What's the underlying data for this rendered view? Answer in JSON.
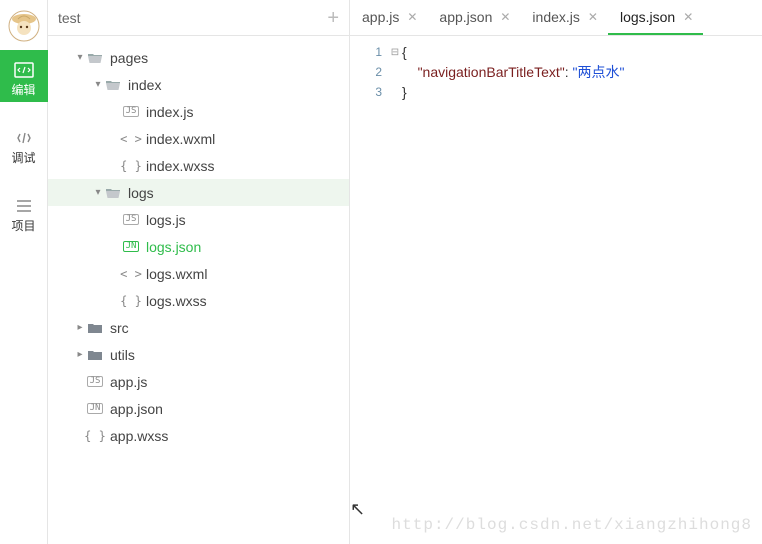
{
  "rail": {
    "items": [
      {
        "name": "编辑",
        "icon": "code-icon",
        "active": true
      },
      {
        "name": "调试",
        "icon": "debug-icon",
        "active": false
      },
      {
        "name": "项目",
        "icon": "menu-icon",
        "active": false
      }
    ]
  },
  "explorer": {
    "title": "test",
    "tree": [
      {
        "label": "pages",
        "type": "folder-open",
        "indent": 1,
        "caret": "down"
      },
      {
        "label": "index",
        "type": "folder-open",
        "indent": 2,
        "caret": "down"
      },
      {
        "label": "index.js",
        "type": "js",
        "indent": 3,
        "caret": ""
      },
      {
        "label": "index.wxml",
        "type": "angle",
        "indent": 3,
        "caret": ""
      },
      {
        "label": "index.wxss",
        "type": "brace",
        "indent": 3,
        "caret": ""
      },
      {
        "label": "logs",
        "type": "folder-open",
        "indent": 2,
        "caret": "down",
        "highlight": true
      },
      {
        "label": "logs.js",
        "type": "js",
        "indent": 3,
        "caret": ""
      },
      {
        "label": "logs.json",
        "type": "jn",
        "indent": 3,
        "caret": "",
        "selected": true
      },
      {
        "label": "logs.wxml",
        "type": "angle",
        "indent": 3,
        "caret": ""
      },
      {
        "label": "logs.wxss",
        "type": "brace",
        "indent": 3,
        "caret": ""
      },
      {
        "label": "src",
        "type": "folder",
        "indent": 1,
        "caret": "right"
      },
      {
        "label": "utils",
        "type": "folder",
        "indent": 1,
        "caret": "right"
      },
      {
        "label": "app.js",
        "type": "js",
        "indent": 1,
        "caret": ""
      },
      {
        "label": "app.json",
        "type": "jn",
        "indent": 1,
        "caret": ""
      },
      {
        "label": "app.wxss",
        "type": "brace",
        "indent": 1,
        "caret": ""
      }
    ]
  },
  "tabs": [
    {
      "label": "app.js",
      "active": false
    },
    {
      "label": "app.json",
      "active": false
    },
    {
      "label": "index.js",
      "active": false
    },
    {
      "label": "logs.json",
      "active": true
    }
  ],
  "code": {
    "lines": [
      {
        "n": "1",
        "fold": "⊟",
        "plain": "{"
      },
      {
        "n": "2",
        "fold": "",
        "indent": "    ",
        "key": "\"navigationBarTitleText\"",
        "colon": ": ",
        "val": "\"两点水\""
      },
      {
        "n": "3",
        "fold": "",
        "plain": "}"
      }
    ]
  },
  "watermark": "http://blog.csdn.net/xiangzhihong8"
}
